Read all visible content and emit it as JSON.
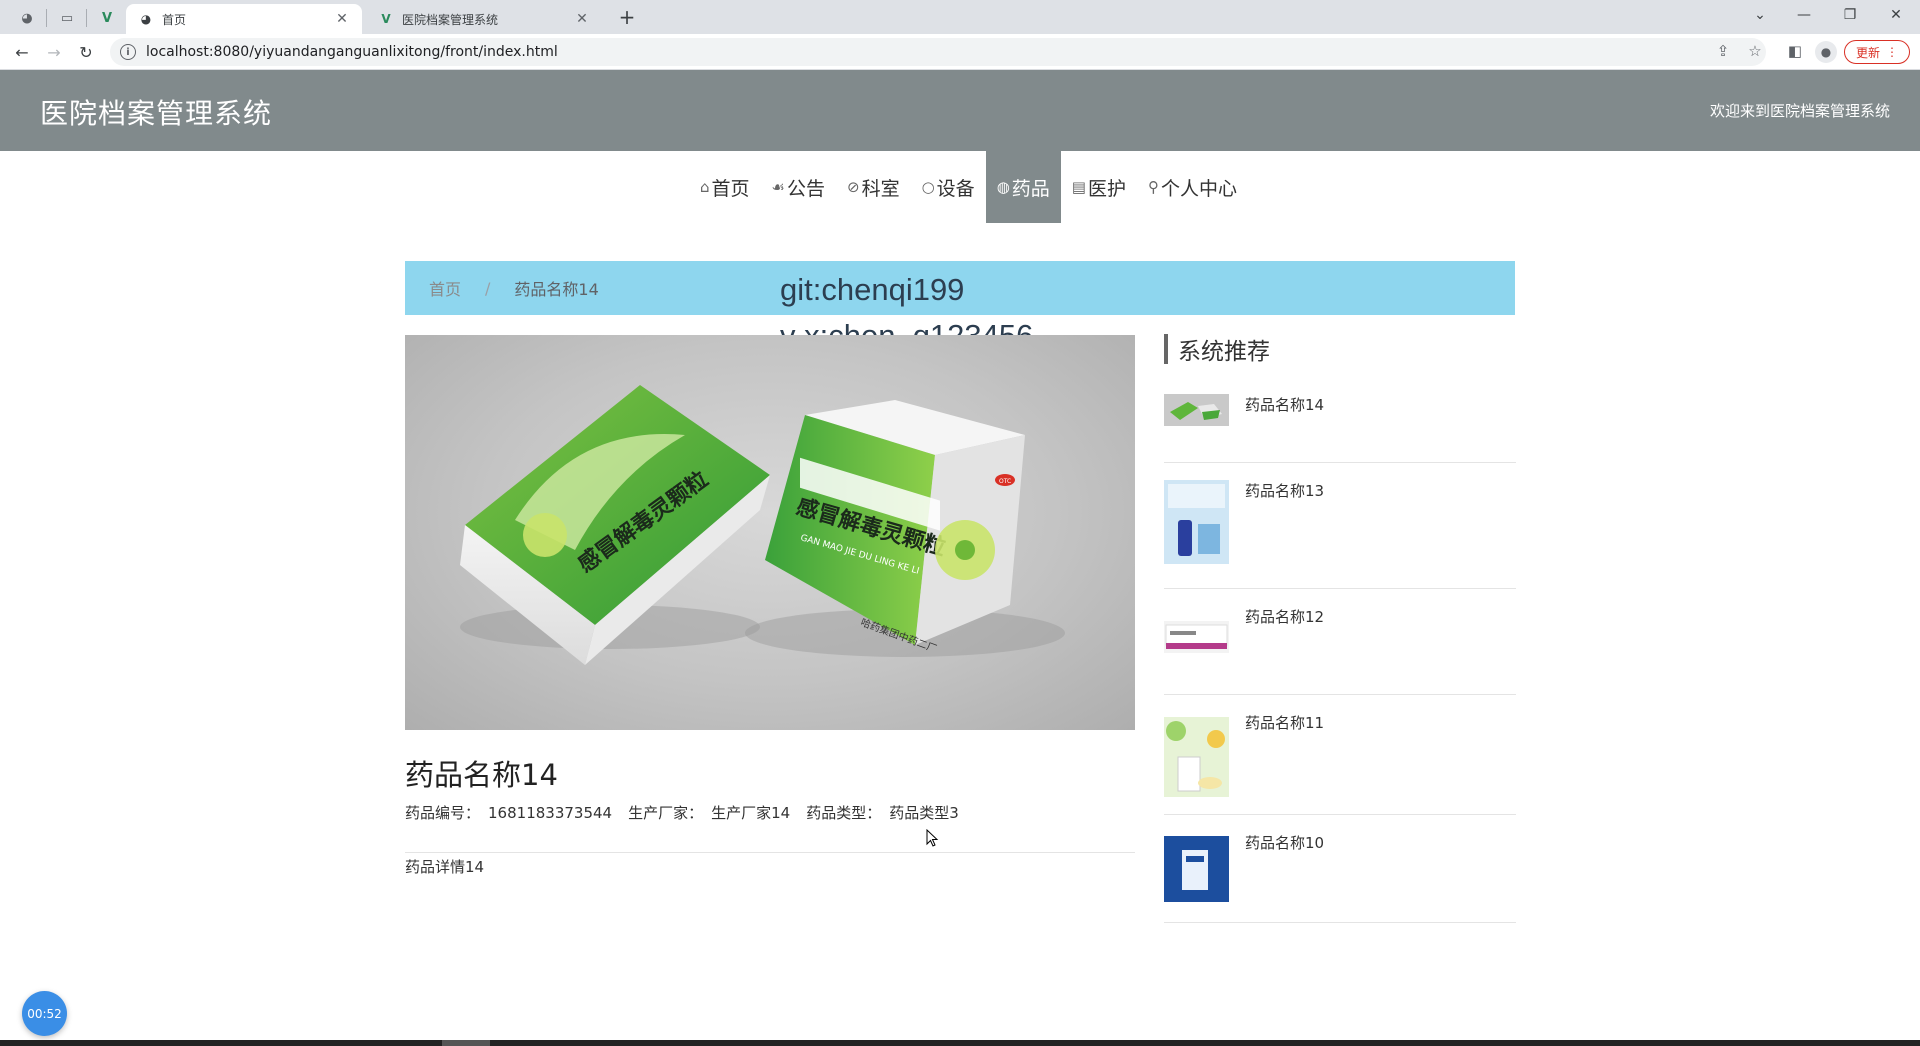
{
  "browser": {
    "tabs": [
      {
        "title": "首页",
        "active": true
      },
      {
        "title": "医院档案管理系统",
        "active": false
      }
    ],
    "url": "localhost:8080/yiyuandanganguanlixitong/front/index.html",
    "update_label": "更新"
  },
  "site": {
    "title": "医院档案管理系统",
    "welcome": "欢迎来到医院档案管理系统"
  },
  "nav": [
    {
      "label": "首页",
      "icon": "home-icon",
      "glyph": "⌂",
      "active": false
    },
    {
      "label": "公告",
      "icon": "palette-icon",
      "glyph": "☙",
      "active": false
    },
    {
      "label": "科室",
      "icon": "tag-icon",
      "glyph": "⊘",
      "active": false
    },
    {
      "label": "设备",
      "icon": "circle-icon",
      "glyph": "○",
      "active": false
    },
    {
      "label": "药品",
      "icon": "globe-icon",
      "glyph": "◍",
      "active": true
    },
    {
      "label": "医护",
      "icon": "document-icon",
      "glyph": "▤",
      "active": false
    },
    {
      "label": "个人中心",
      "icon": "user-icon",
      "glyph": "⚲",
      "active": false
    }
  ],
  "breadcrumb": {
    "home": "首页",
    "separator": "/",
    "current": "药品名称14"
  },
  "watermark": {
    "line1": "git:chenqi199",
    "line2": "v x:chen_q123456"
  },
  "product": {
    "name": "药品名称14",
    "fields": [
      {
        "label": "药品编号：",
        "value": "1681183373544"
      },
      {
        "label": "生产厂家：",
        "value": "生产厂家14"
      },
      {
        "label": "药品类型：",
        "value": "药品类型3"
      }
    ],
    "description": "药品详情14",
    "image_text": {
      "cn": "感冒解毒灵颗粒",
      "en": "GAN MAO JIE DU LING KE LI",
      "maker": "哈药集团中药二厂",
      "badge": "OTC"
    }
  },
  "sidebar": {
    "title": "系统推荐",
    "items": [
      {
        "name": "药品名称14"
      },
      {
        "name": "药品名称13"
      },
      {
        "name": "药品名称12"
      },
      {
        "name": "药品名称11"
      },
      {
        "name": "药品名称10"
      }
    ]
  },
  "timer": "00:52",
  "colors": {
    "header_bg": "#818a8c",
    "breadcrumb_bg": "#8ed6ee",
    "timer_bg": "#3a8ee6",
    "update_red": "#d93025"
  }
}
